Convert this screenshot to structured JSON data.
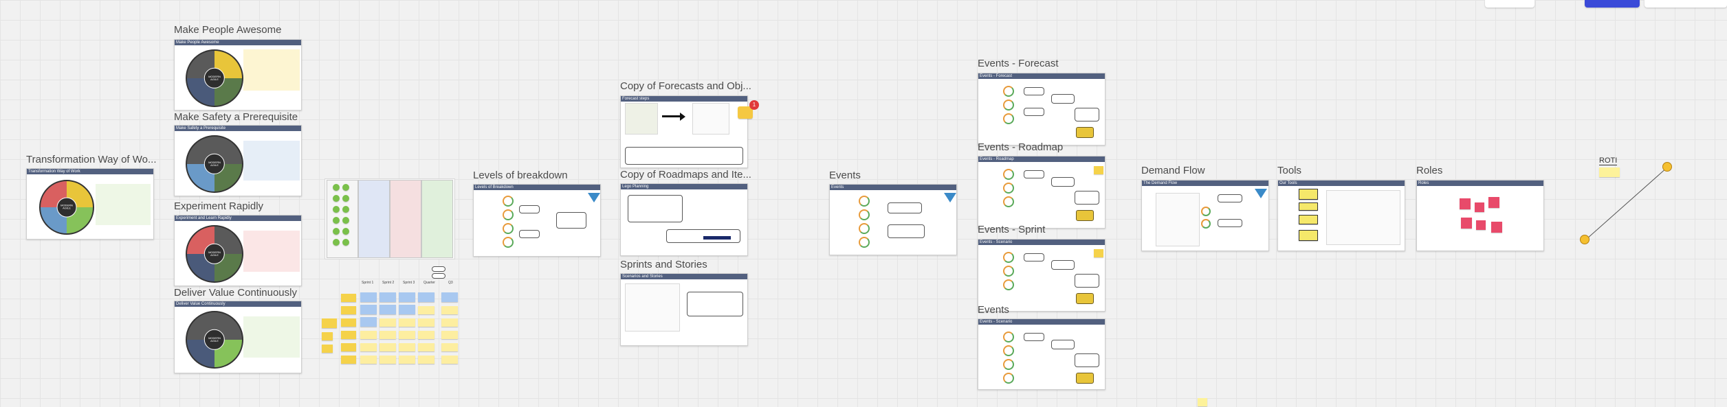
{
  "board": {
    "frames": [
      {
        "id": "transformation",
        "title": "Transformation Way of Wo...",
        "header": "Transformation Way of Work",
        "wheel_center": "MODERN AGILE"
      },
      {
        "id": "awesome",
        "title": "Make People Awesome",
        "header": "Make People Awesome",
        "wheel_center": "MODERN AGILE"
      },
      {
        "id": "safety",
        "title": "Make Safety a Prerequisite",
        "header": "Make Safety a Prerequisite",
        "wheel_center": "MODERN AGILE"
      },
      {
        "id": "experiment",
        "title": "Experiment Rapidly",
        "header": "Experiment and Learn Rapidly",
        "wheel_center": "MODERN AGILE"
      },
      {
        "id": "deliver",
        "title": "Deliver Value Continuously",
        "header": "Deliver Value Continuously",
        "wheel_center": "MODERN AGILE"
      },
      {
        "id": "levels",
        "title": "Levels of breakdown",
        "header": "Levels of Breakdown"
      },
      {
        "id": "forecasts",
        "title": "Copy of Forecasts and Obj...",
        "header": "Forecast steps"
      },
      {
        "id": "roadmaps",
        "title": "Copy of Roadmaps and Ite...",
        "header": "Lego Planning"
      },
      {
        "id": "sprints",
        "title": "Sprints and Stories",
        "header": "Scenarios and Stories"
      },
      {
        "id": "events",
        "title": "Events",
        "header": "Events"
      },
      {
        "id": "events-forecast",
        "title": "Events - Forecast",
        "header": "Events - Forecast"
      },
      {
        "id": "events-roadmap",
        "title": "Events - Roadmap",
        "header": "Events - Roadmap"
      },
      {
        "id": "events-sprint",
        "title": "Events - Sprint",
        "header": "Events - Scenario"
      },
      {
        "id": "events-2",
        "title": "Events",
        "header": "Events - Scenario"
      },
      {
        "id": "demand",
        "title": "Demand Flow",
        "header": "The Demand Flow"
      },
      {
        "id": "tools",
        "title": "Tools",
        "header": "Our Tools"
      },
      {
        "id": "roles",
        "title": "Roles",
        "header": "Roles"
      }
    ],
    "comment_badge_count": "1",
    "roti_label": "ROTI",
    "swimlane_columns": [
      "Sprint 1",
      "Sprint 2",
      "Sprint 3",
      "Quarter",
      "Q3"
    ]
  }
}
